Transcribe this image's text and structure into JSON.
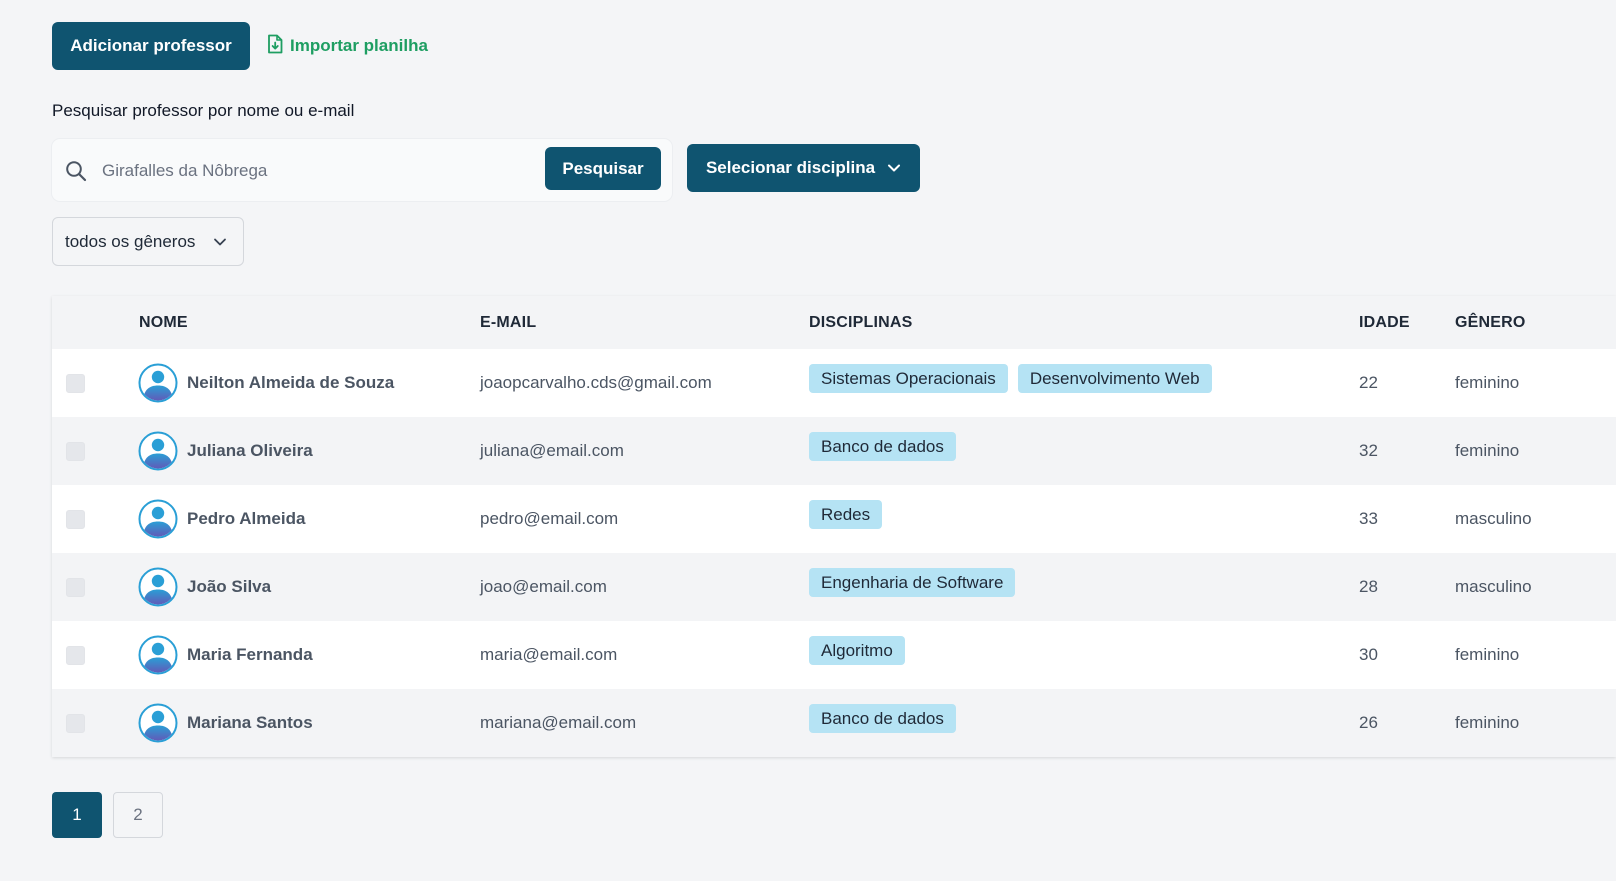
{
  "toolbar": {
    "add_teacher_label": "Adicionar professor",
    "import_label": "Importar planilha"
  },
  "search": {
    "label": "Pesquisar professor por nome ou e-mail",
    "placeholder": "Girafalles da Nôbrega",
    "button_label": "Pesquisar"
  },
  "filters": {
    "discipline_label": "Selecionar disciplina",
    "gender_value": "todos os gêneros"
  },
  "table": {
    "headers": {
      "name": "NOME",
      "email": "E-MAIL",
      "disciplines": "DISCIPLINAS",
      "age": "IDADE",
      "gender": "GÊNERO"
    },
    "rows": [
      {
        "name": "Neilton Almeida de Souza",
        "email": "joaopcarvalho.cds@gmail.com",
        "tags": [
          "Sistemas Operacionais",
          "Desenvolvimento Web"
        ],
        "age": "22",
        "gender": "feminino"
      },
      {
        "name": "Juliana Oliveira",
        "email": "juliana@email.com",
        "tags": [
          "Banco de dados"
        ],
        "age": "32",
        "gender": "feminino"
      },
      {
        "name": "Pedro Almeida",
        "email": "pedro@email.com",
        "tags": [
          "Redes"
        ],
        "age": "33",
        "gender": "masculino"
      },
      {
        "name": "João Silva",
        "email": "joao@email.com",
        "tags": [
          "Engenharia de Software"
        ],
        "age": "28",
        "gender": "masculino"
      },
      {
        "name": "Maria Fernanda",
        "email": "maria@email.com",
        "tags": [
          "Algoritmo"
        ],
        "age": "30",
        "gender": "feminino"
      },
      {
        "name": "Mariana Santos",
        "email": "mariana@email.com",
        "tags": [
          "Banco de dados"
        ],
        "age": "26",
        "gender": "feminino"
      }
    ]
  },
  "pagination": {
    "pages": [
      "1",
      "2"
    ],
    "current": "1"
  },
  "colors": {
    "primary": "#0f5470",
    "import_green": "#1e9e62",
    "tag_bg": "#b5e3f4"
  },
  "icons": {
    "import": "file-import-icon",
    "search": "search-icon",
    "dropdown": "chevron-down-icon",
    "avatar": "user-avatar-icon"
  }
}
